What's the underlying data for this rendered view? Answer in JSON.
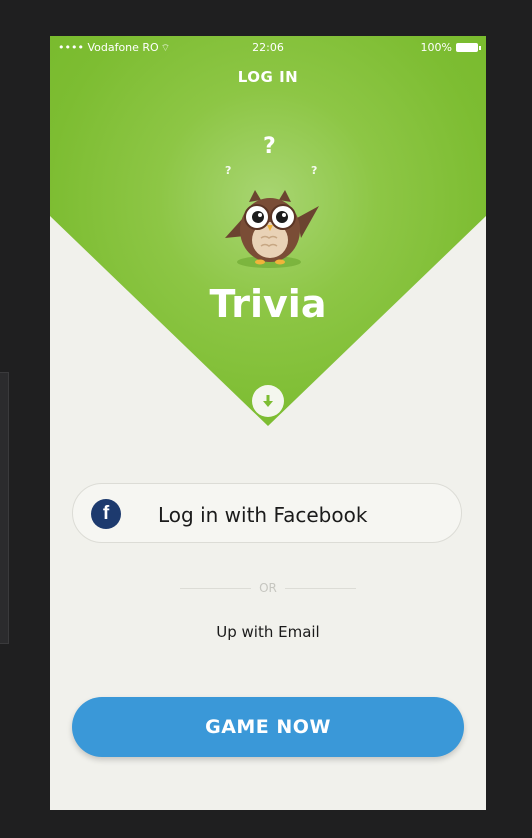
{
  "status_bar": {
    "carrier": "•••• Vodafone RO",
    "time": "22:06",
    "battery": "100%"
  },
  "nav": {
    "title": "LOG IN"
  },
  "hero": {
    "question_marks": [
      "?",
      "?",
      "?"
    ],
    "app_name": "Trivia"
  },
  "login": {
    "facebook_label": "Log in with Facebook",
    "facebook_glyph": "f",
    "or_text": "OR",
    "email_link": "Up with Email",
    "primary_button": "GAME NOW"
  },
  "colors": {
    "green": "#7dbd32",
    "facebook_blue": "#1d3a6e",
    "primary_blue": "#3a98d8",
    "screen_bg": "#f1f1ec",
    "frame_bg": "#1f1f20"
  },
  "icons": {
    "logo": "owl-icon",
    "scroll": "arrow-down-icon",
    "facebook": "facebook-icon",
    "wifi": "wifi-icon",
    "battery": "battery-icon"
  }
}
